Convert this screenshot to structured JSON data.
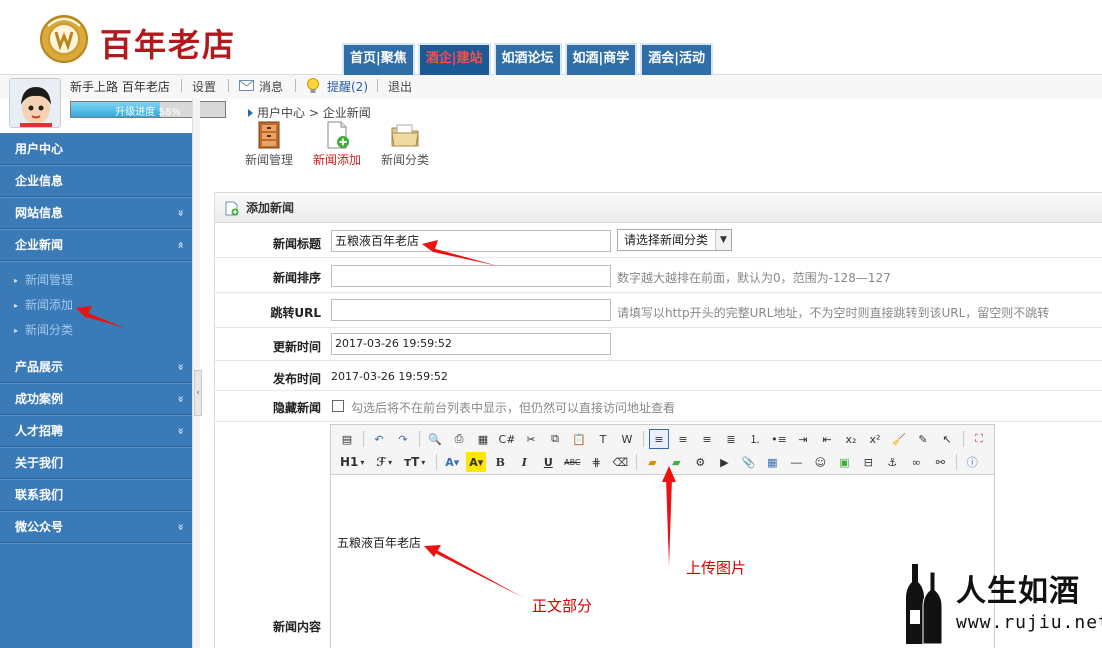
{
  "header": {
    "brand_text": "百年老店",
    "nav_tabs": [
      {
        "label": "首页|聚焦",
        "active": false
      },
      {
        "label": "酒企|建站",
        "active": true
      },
      {
        "label": "如酒论坛",
        "active": false
      },
      {
        "label": "如酒|商学",
        "active": false
      },
      {
        "label": "酒会|活动",
        "active": false
      }
    ]
  },
  "userbar": {
    "username": "新手上路 百年老店",
    "settings": "设置",
    "messages": "消息",
    "reminders": "提醒(2)",
    "logout": "退出",
    "progress_label": "升级进度",
    "progress_value": "58%",
    "progress_fraction": 0.58
  },
  "breadcrumb": {
    "root": "用户中心",
    "sep": ">",
    "current": "企业新闻"
  },
  "sidebar": {
    "items": [
      {
        "label": "用户中心",
        "chevron": ""
      },
      {
        "label": "企业信息",
        "chevron": ""
      },
      {
        "label": "网站信息",
        "chevron": "»"
      },
      {
        "label": "企业新闻",
        "chevron": "«"
      },
      {
        "label": "产品展示",
        "chevron": "»"
      },
      {
        "label": "成功案例",
        "chevron": "»"
      },
      {
        "label": "人才招聘",
        "chevron": "»"
      },
      {
        "label": "关于我们",
        "chevron": ""
      },
      {
        "label": "联系我们",
        "chevron": ""
      },
      {
        "label": "微公众号",
        "chevron": "»"
      }
    ],
    "subitems": [
      "新闻管理",
      "新闻添加",
      "新闻分类"
    ]
  },
  "toolbar": {
    "news_manage": "新闻管理",
    "news_add": "新闻添加",
    "news_category": "新闻分类"
  },
  "form": {
    "panel_title": "添加新闻",
    "title_label": "新闻标题",
    "title_value": "五粮液百年老店",
    "category_select": "请选择新闻分类",
    "order_label": "新闻排序",
    "order_hint": "数字越大越排在前面，默认为0，范围为-128—127",
    "url_label": "跳转URL",
    "url_hint": "请填写以http开头的完整URL地址，不为空时则直接跳转到该URL，留空则不跳转",
    "update_label": "更新时间",
    "update_value": "2017-03-26 19:59:52",
    "publish_label": "发布时间",
    "publish_value": "2017-03-26 19:59:52",
    "hide_label": "隐藏新闻",
    "hide_hint": "勾选后将不在前台列表中显示，但仍然可以直接访问地址查看",
    "content_label": "新闻内容"
  },
  "editor": {
    "heading_drop": "H1",
    "font_drop": "ℱ",
    "size_drop": "тT",
    "body_text": "五粮液百年老店"
  },
  "annotations": {
    "upload_image": "上传图片",
    "body_section": "正文部分"
  },
  "watermark": {
    "title": "人生如酒",
    "domain": "www.rujiu.net"
  },
  "colors": {
    "accent_blue": "#3a7ab6",
    "nav_active_text": "#ff4b4b",
    "annotation_red": "#d40000"
  }
}
